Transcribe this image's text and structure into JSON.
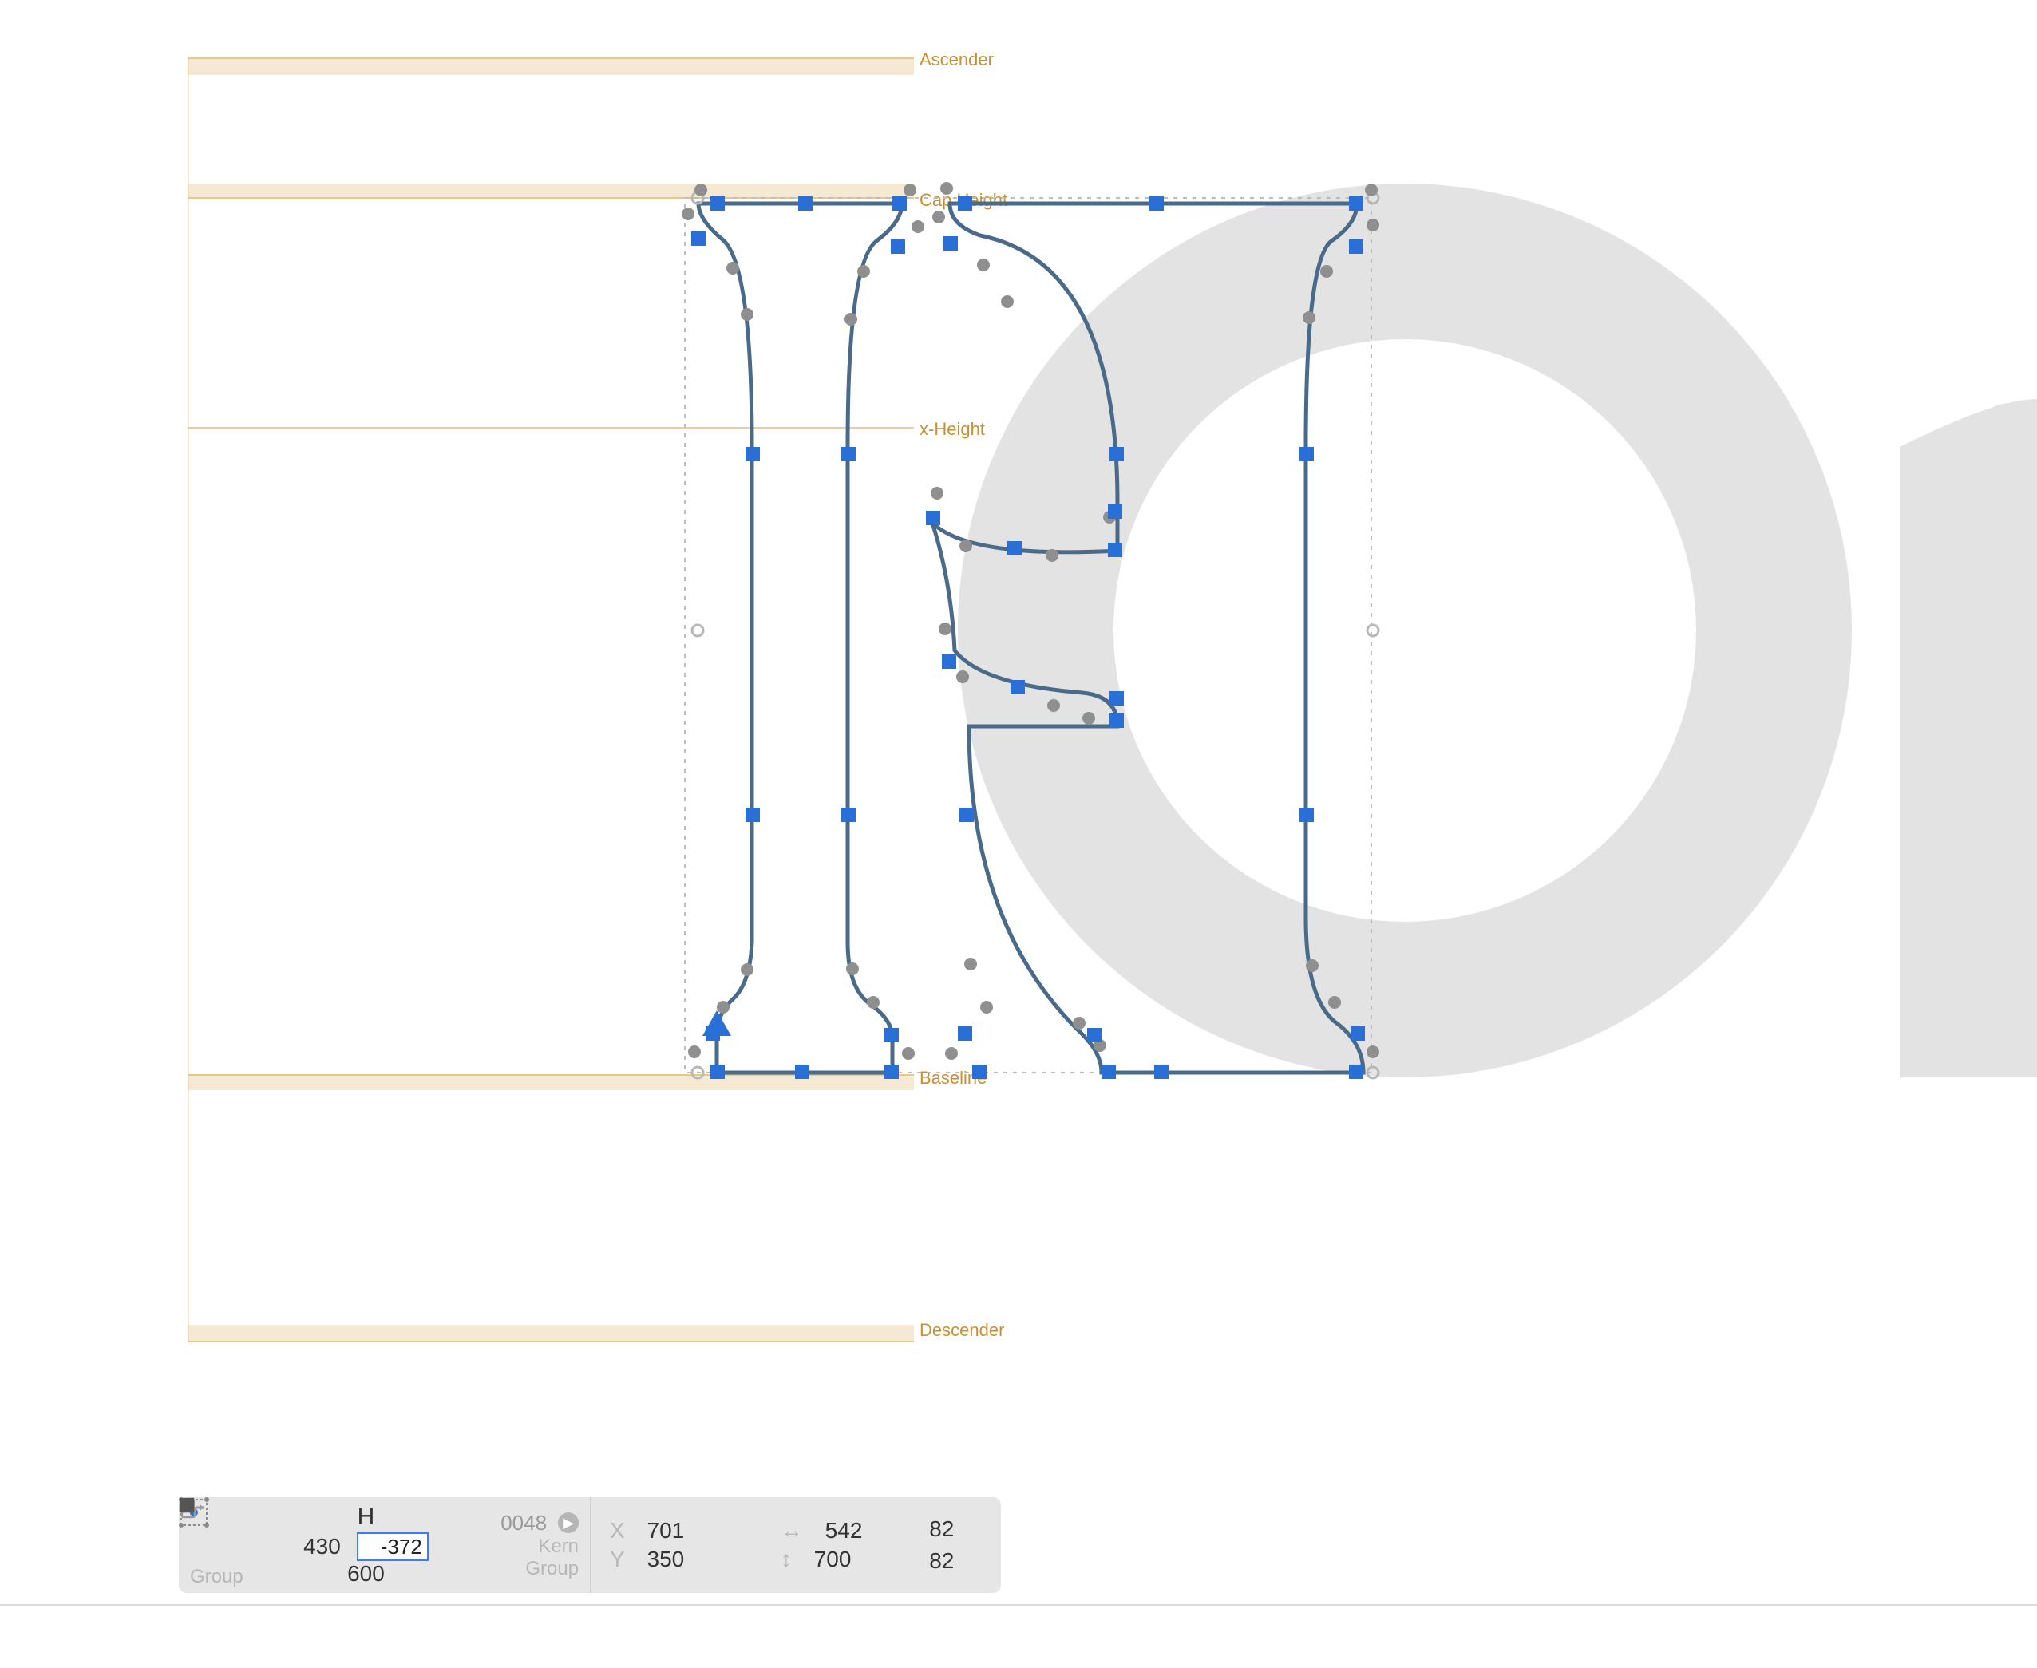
{
  "metrics": {
    "ascender": "Ascender",
    "capHeight": "Cap Height",
    "xHeight": "x-Height",
    "baseline": "Baseline",
    "descender": "Descender"
  },
  "status": {
    "glyphName": "H",
    "unicode": "0048",
    "lsb": "430",
    "rsb": "-372",
    "width": "600",
    "kernLabel": "Kern",
    "groupLabel": "Group",
    "x": "701",
    "xLabel": "X",
    "y": "350",
    "yLabel": "Y",
    "w": "542",
    "h": "700",
    "nodesOutline": "82",
    "nodesFilled": "82"
  }
}
